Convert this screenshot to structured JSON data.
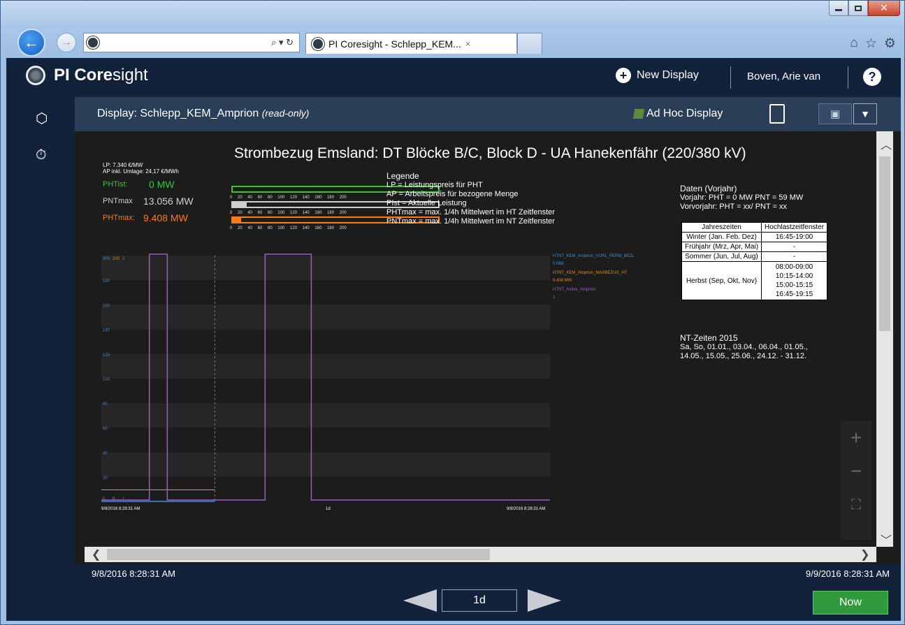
{
  "browser": {
    "address_value": "",
    "tab_title": "PI Coresight - Schlepp_KEM...",
    "tab_close": "×"
  },
  "app": {
    "brand_bold": "PI Core",
    "brand_light": "sight",
    "new_display": "New Display",
    "user": "Boven, Arie van",
    "help": "?"
  },
  "displaybar": {
    "label": "Display:",
    "name": "Schlepp_KEM_Amprion",
    "mode": "(read-only)",
    "adhoc": "Ad Hoc Display"
  },
  "display": {
    "title": "Strombezug Emsland: DT Blöcke B/C, Block D - UA Hanekenfähr (220/380 kV)",
    "lp_line": "LP: 7.340 €/MW",
    "ap_line": "AP inkl. Umlage: 24,17 €/MWh",
    "kpis": [
      {
        "label": "PHTist:",
        "value": "0  MW",
        "color": "#3cc23c"
      },
      {
        "label": "PNTmax",
        "value": "13.056  MW",
        "color": "#cfcfcf"
      },
      {
        "label": "PHTmax:",
        "value": "9.408  MW",
        "color": "#ff7a18"
      }
    ],
    "gauge_ticks": "0 20 40 60 80 100 120 140 160 180 200",
    "legend": {
      "title": "Legende",
      "lines": [
        "LP = Leistungspreis für PHT",
        "AP = Arbeitspreis für bezogene Menge",
        "PIst = Aktuelle Leistung",
        "PHTmax = max. 1/4h Mittelwert im HT Zeitfenster",
        "PNTmax = max. 1/4h Mittelwert im NT Zeitfenster"
      ]
    },
    "daten": {
      "title": "Daten (Vorjahr)",
      "lines": [
        "Vorjahr: PHT = 0 MW PNT = 59 MW",
        "Vorvorjahr: PHT = xx/ PNT = xx"
      ]
    },
    "table": {
      "headers": [
        "Jahreszeiten",
        "Hochlastzeitfenster"
      ],
      "rows": [
        [
          "Winter (Jan. Feb. Dez)",
          "16:45-19:00"
        ],
        [
          "Frühjahr (Mrz, Apr, Mai)",
          "-"
        ],
        [
          "Sommer (Jun, Jul, Aug)",
          "-"
        ],
        [
          "Herbst (Sep, Okt, Nov)",
          "08:00-09:00\n10:15-14:00\n15:00-15:15\n16:45-19:15"
        ]
      ]
    },
    "nt": {
      "title": "NT-Zeiten 2015",
      "lines": [
        "Sa, So, 01.01., 03.04., 06.04., 01.05.,",
        "14.05., 15.05., 25.06., 24.12. - 31.12."
      ]
    },
    "trend_legend": [
      {
        "name": "HTNT_KEM_Amprion_VORL_PERM_BEZL",
        "value": "0 MW",
        "color": "#3a8fd6"
      },
      {
        "name": "HTNT_KEM_Amprion_MAXBEZUG_HT",
        "value": "9.408 MW",
        "color": "#e08a1c"
      },
      {
        "name": "HTNT_Active_Amprion",
        "value": "1",
        "color": "#9b59d8"
      }
    ]
  },
  "chart_data": {
    "type": "line",
    "x_start": "9/8/2016 8:28:31 AM",
    "x_end": "9/9/2016 8:28:31 AM",
    "x_center_label": "1d",
    "ylim": [
      0,
      200
    ],
    "y_ticks": [
      20,
      40,
      60,
      80,
      100,
      120,
      140,
      160,
      180
    ],
    "y_top_labels": [
      "200",
      "200",
      "2"
    ],
    "y_bottom_labels": [
      "0",
      "0",
      "1"
    ],
    "series": [
      {
        "name": "HTNT_KEM_Amprion_VORL_PERM_BEZL",
        "color": "#3a8fd6",
        "values": [
          0,
          0
        ]
      },
      {
        "name": "HTNT_KEM_Amprion_MAXBEZUG_HT",
        "color": "#e08a1c",
        "segments": [
          [
            0.0,
            0.253,
            9.408
          ]
        ]
      },
      {
        "name": "HTNT_Active_Amprion",
        "color": "#9b59d8",
        "pulses": [
          [
            0.107,
            0.147
          ],
          [
            0.365,
            0.468
          ]
        ]
      }
    ]
  },
  "time": {
    "start": "9/8/2016 8:28:31 AM",
    "end": "9/9/2016 8:28:31 AM",
    "range": "1d",
    "now": "Now"
  }
}
